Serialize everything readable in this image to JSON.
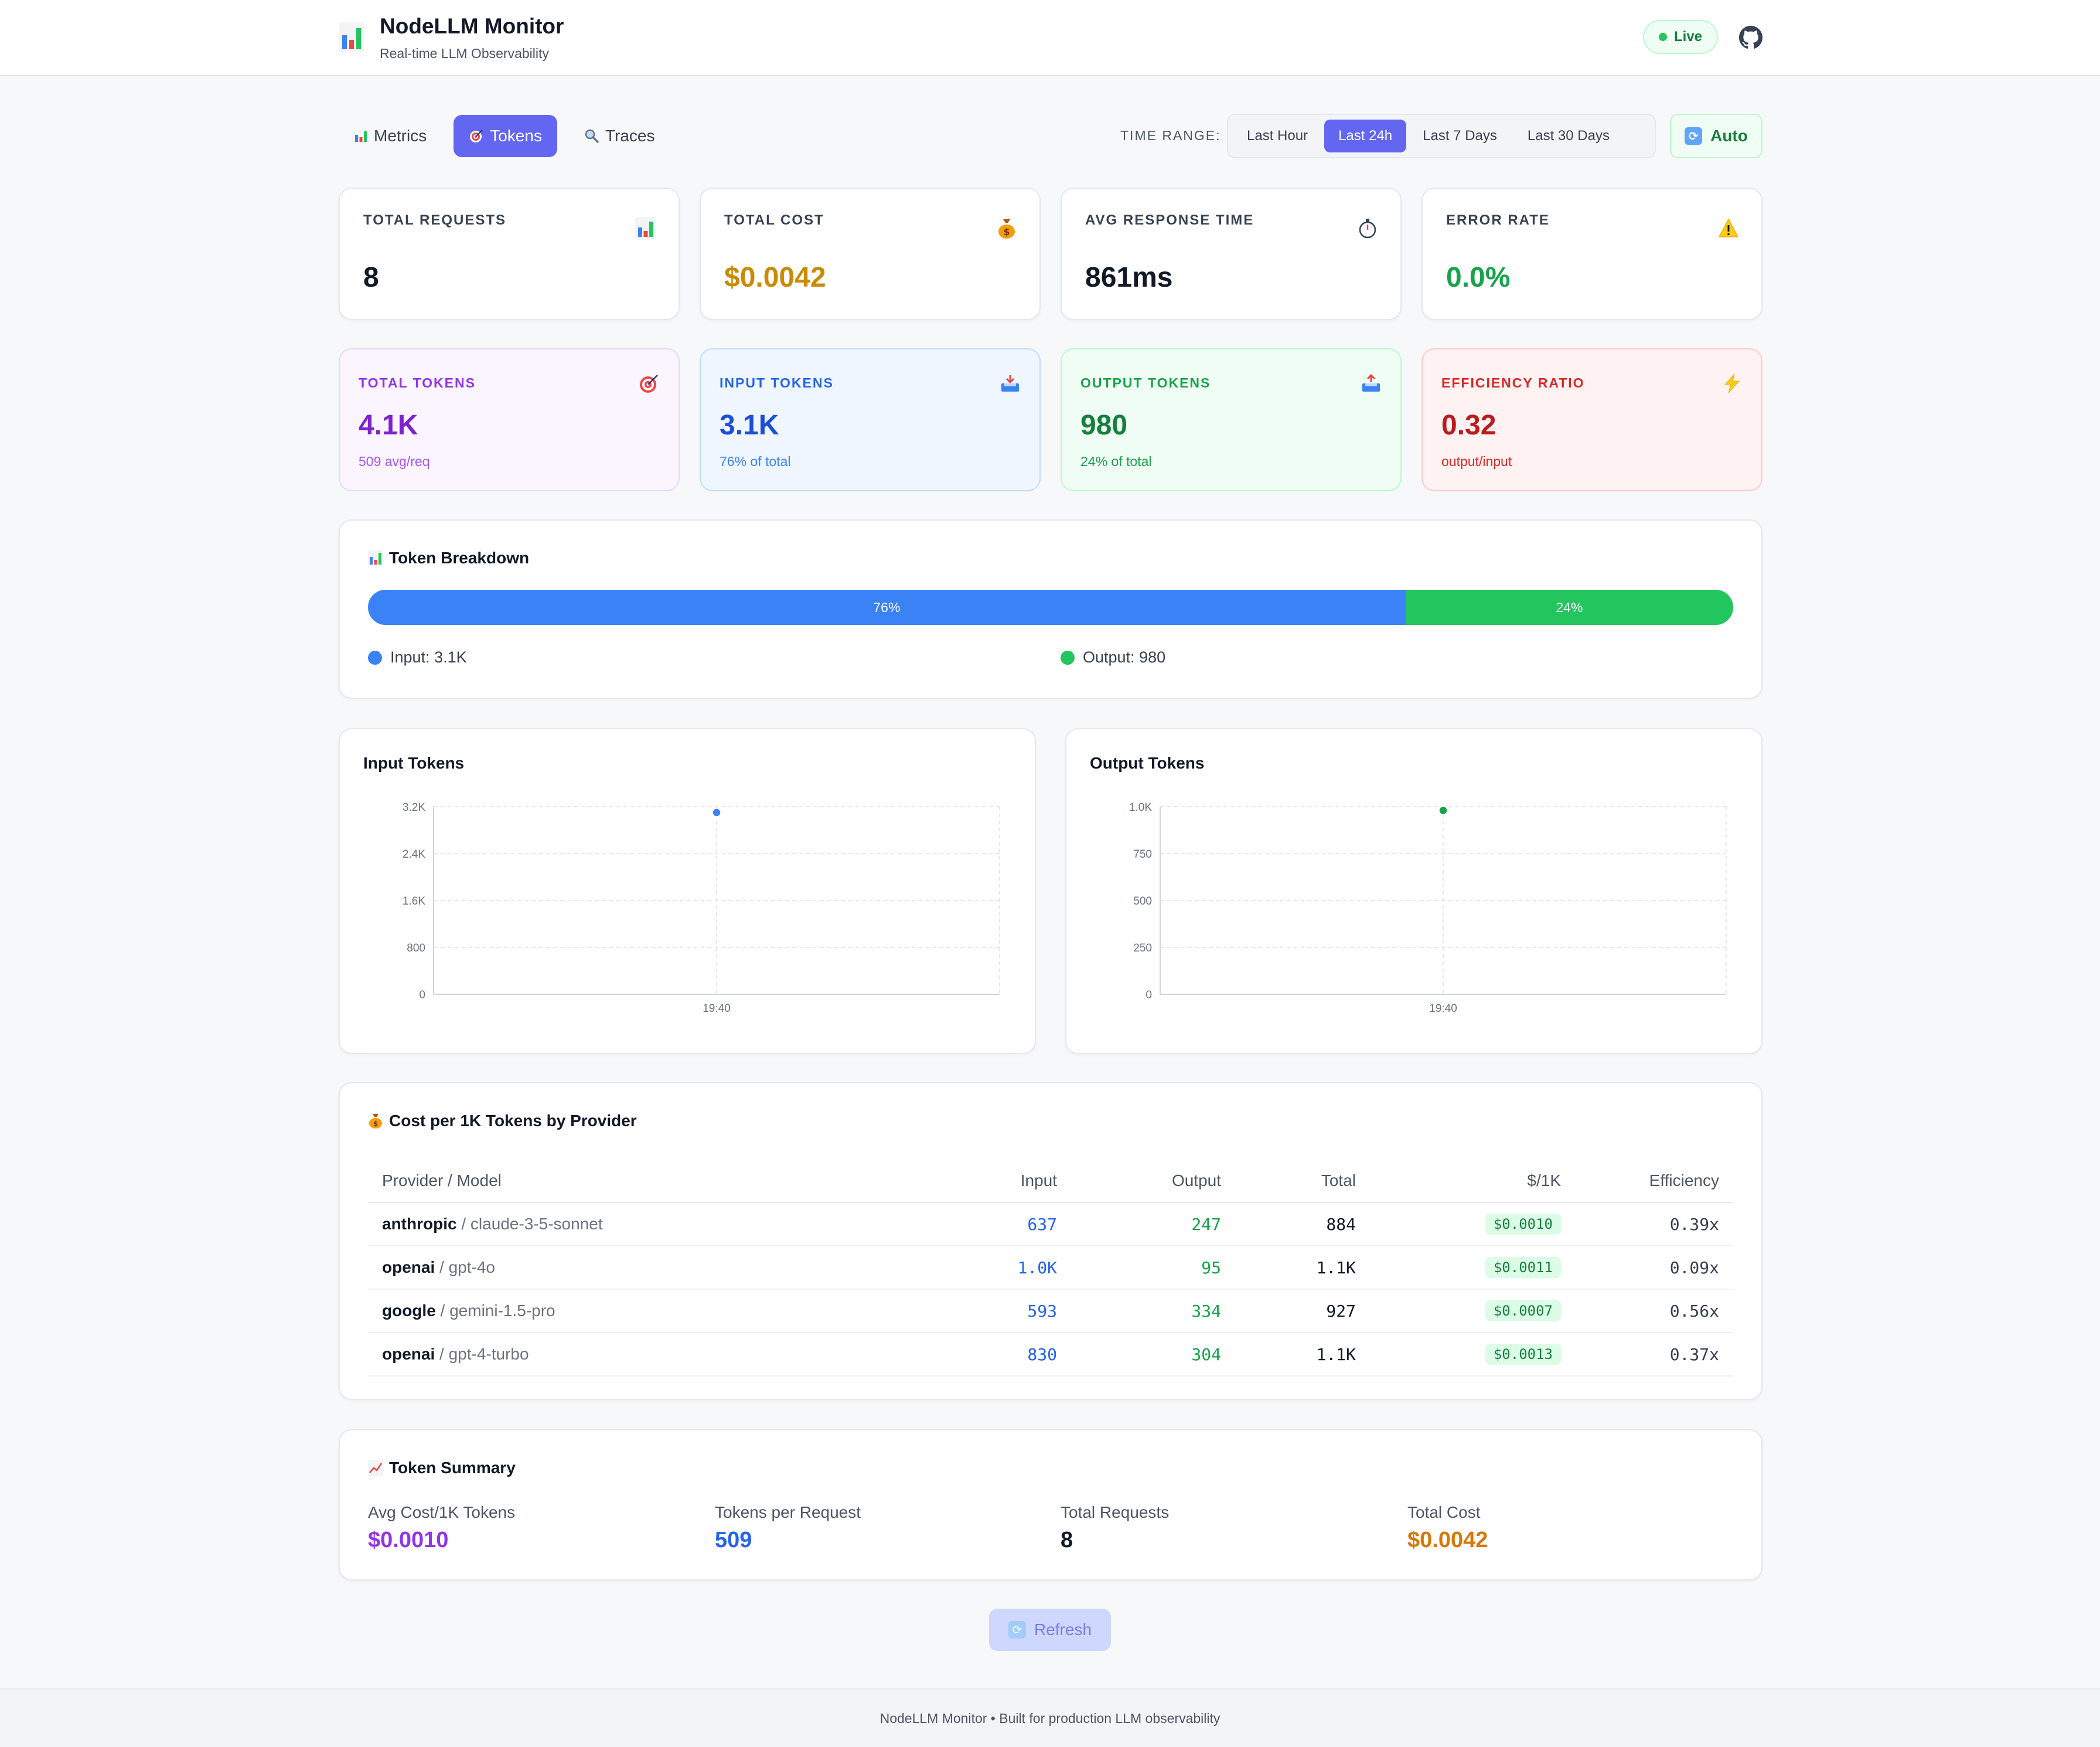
{
  "header": {
    "title": "NodeLLM Monitor",
    "subtitle": "Real-time LLM Observability",
    "live_label": "Live"
  },
  "tabs": [
    {
      "label": "Metrics",
      "icon": "bar-chart-icon",
      "active": false
    },
    {
      "label": "Tokens",
      "icon": "target-icon",
      "active": true
    },
    {
      "label": "Traces",
      "icon": "magnifier-icon",
      "active": false
    }
  ],
  "time_range": {
    "label": "TIME RANGE:",
    "options": [
      "Last Hour",
      "Last 24h",
      "Last 7 Days",
      "Last 30 Days"
    ],
    "selected": "Last 24h",
    "auto_label": "Auto"
  },
  "stats": [
    {
      "label": "TOTAL REQUESTS",
      "value": "8",
      "icon": "bar-chart-icon",
      "color": "#111827"
    },
    {
      "label": "TOTAL COST",
      "value": "$0.0042",
      "icon": "money-bag-icon",
      "color": "#ca8a04"
    },
    {
      "label": "AVG RESPONSE TIME",
      "value": "861ms",
      "icon": "stopwatch-icon",
      "color": "#111827"
    },
    {
      "label": "ERROR RATE",
      "value": "0.0%",
      "icon": "warning-icon",
      "color": "#16a34a"
    }
  ],
  "token_cards": [
    {
      "label": "TOTAL TOKENS",
      "value": "4.1K",
      "sub": "509 avg/req",
      "icon": "target-icon"
    },
    {
      "label": "INPUT TOKENS",
      "value": "3.1K",
      "sub": "76% of total",
      "icon": "inbox-icon"
    },
    {
      "label": "OUTPUT TOKENS",
      "value": "980",
      "sub": "24% of total",
      "icon": "outbox-icon"
    },
    {
      "label": "EFFICIENCY RATIO",
      "value": "0.32",
      "sub": "output/input",
      "icon": "lightning-icon"
    }
  ],
  "breakdown": {
    "title": "Token Breakdown",
    "input_pct_label": "76%",
    "output_pct_label": "24%",
    "input_fraction": 0.76,
    "input_legend": "Input: 3.1K",
    "output_legend": "Output: 980",
    "input_color": "#3b82f6",
    "output_color": "#22c55e"
  },
  "chart_data": [
    {
      "type": "line",
      "title": "Input Tokens",
      "x": [
        "19:40"
      ],
      "series": [
        {
          "values": [
            3100
          ]
        }
      ],
      "ylim": [
        0,
        3200
      ],
      "yticks": [
        0,
        800,
        1600,
        2400,
        3200
      ],
      "ytick_labels": [
        "0",
        "800",
        "1.6K",
        "2.4K",
        "3.2K"
      ],
      "grid": true,
      "color": "#3b82f6"
    },
    {
      "type": "line",
      "title": "Output Tokens",
      "x": [
        "19:40"
      ],
      "series": [
        {
          "values": [
            980
          ]
        }
      ],
      "ylim": [
        0,
        1000
      ],
      "yticks": [
        0,
        250,
        500,
        750,
        1000
      ],
      "ytick_labels": [
        "0",
        "250",
        "500",
        "750",
        "1.0K"
      ],
      "grid": true,
      "color": "#16a34a"
    }
  ],
  "cost_table": {
    "title": "Cost per 1K Tokens by Provider",
    "columns": [
      "Provider / Model",
      "Input",
      "Output",
      "Total",
      "$/1K",
      "Efficiency"
    ],
    "rows": [
      {
        "provider": "anthropic",
        "model": "/ claude-3-5-sonnet",
        "input": "637",
        "output": "247",
        "total": "884",
        "cost": "$0.0010",
        "eff": "0.39x"
      },
      {
        "provider": "openai",
        "model": "/ gpt-4o",
        "input": "1.0K",
        "output": "95",
        "total": "1.1K",
        "cost": "$0.0011",
        "eff": "0.09x"
      },
      {
        "provider": "google",
        "model": "/ gemini-1.5-pro",
        "input": "593",
        "output": "334",
        "total": "927",
        "cost": "$0.0007",
        "eff": "0.56x"
      },
      {
        "provider": "openai",
        "model": "/ gpt-4-turbo",
        "input": "830",
        "output": "304",
        "total": "1.1K",
        "cost": "$0.0013",
        "eff": "0.37x"
      }
    ]
  },
  "summary": {
    "title": "Token Summary",
    "items": [
      {
        "label": "Avg Cost/1K Tokens",
        "value": "$0.0010",
        "color": "#9333ea"
      },
      {
        "label": "Tokens per Request",
        "value": "509",
        "color": "#2563eb"
      },
      {
        "label": "Total Requests",
        "value": "8",
        "color": "#111827"
      },
      {
        "label": "Total Cost",
        "value": "$0.0042",
        "color": "#d97706"
      }
    ]
  },
  "refresh_label": "Refresh",
  "footer": "NodeLLM Monitor • Built for production LLM observability"
}
